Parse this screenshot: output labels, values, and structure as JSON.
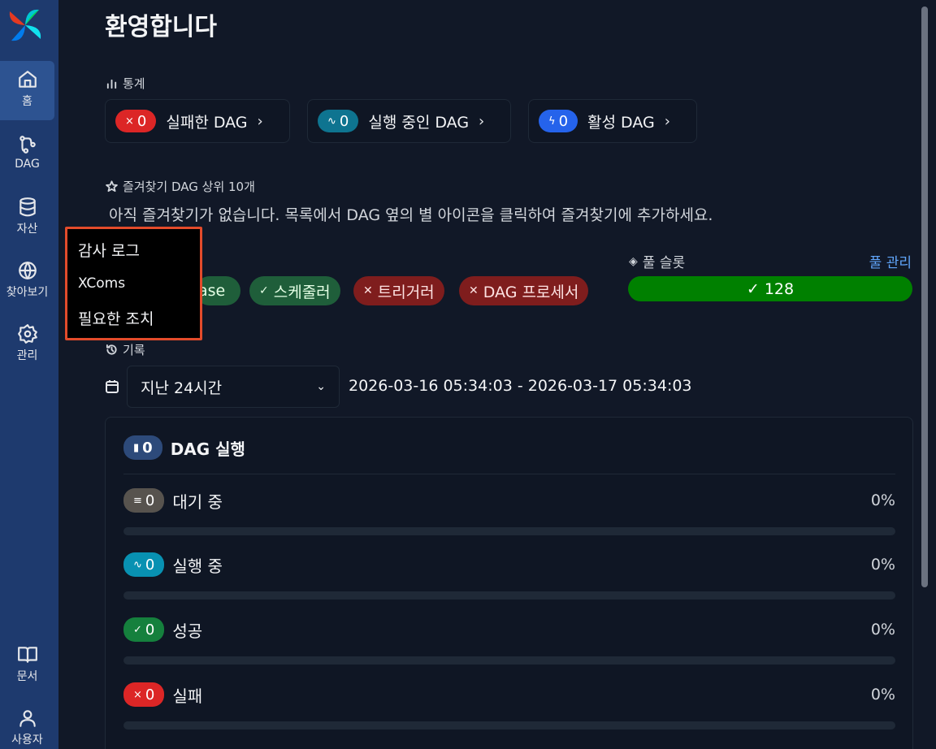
{
  "sidebar": {
    "items": [
      {
        "label": "홈",
        "icon": "home-icon"
      },
      {
        "label": "DAG",
        "icon": "dag-icon"
      },
      {
        "label": "자산",
        "icon": "database-icon"
      },
      {
        "label": "찾아보기",
        "icon": "globe-icon"
      },
      {
        "label": "관리",
        "icon": "gear-icon"
      },
      {
        "label": "문서",
        "icon": "book-icon"
      },
      {
        "label": "사용자",
        "icon": "user-icon"
      }
    ]
  },
  "page": {
    "title": "환영합니다"
  },
  "stats": {
    "heading": "통계",
    "cards": [
      {
        "count": "0",
        "label": "실패한 DAG",
        "color": "#dc2626",
        "icon": "×"
      },
      {
        "count": "0",
        "label": "실행 중인 DAG",
        "color": "#0e7490",
        "icon": "∿"
      },
      {
        "count": "0",
        "label": "활성 DAG",
        "color": "#2563eb",
        "icon": "ϟ"
      }
    ]
  },
  "favorites": {
    "heading": "즐겨찾기 DAG 상위 10개",
    "empty_message": "아직 즐겨찾기가 없습니다. 목록에서 DAG 옆의 별 아이콘을 클릭하여 즐겨찾기에 추가하세요."
  },
  "health": {
    "items": [
      {
        "label": "ase",
        "status": "ok"
      },
      {
        "label": "스케줄러",
        "status": "ok"
      },
      {
        "label": "트리거러",
        "status": "fail"
      },
      {
        "label": "DAG 프로세서",
        "status": "fail"
      }
    ]
  },
  "pool": {
    "heading": "풀 슬롯",
    "manage_link": "풀 관리",
    "value": "128",
    "color": "#008000"
  },
  "history": {
    "heading": "기록",
    "range_select": "지난 24시간",
    "date_range": "2026-03-16 05:34:03 - 2026-03-17 05:34:03"
  },
  "dag_runs": {
    "title": "DAG 실행",
    "count": "0",
    "rows": [
      {
        "label": "대기 중",
        "count": "0",
        "percent": "0%",
        "color": "#57534e",
        "icon": "≡"
      },
      {
        "label": "실행 중",
        "count": "0",
        "percent": "0%",
        "color": "#0891b2",
        "icon": "∿"
      },
      {
        "label": "성공",
        "count": "0",
        "percent": "0%",
        "color": "#15803d",
        "icon": "✓"
      },
      {
        "label": "실패",
        "count": "0",
        "percent": "0%",
        "color": "#dc2626",
        "icon": "×"
      }
    ]
  },
  "popup_menu": {
    "items": [
      "감사 로그",
      "XComs",
      "필요한 조치"
    ]
  }
}
